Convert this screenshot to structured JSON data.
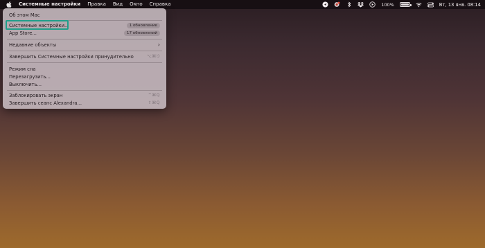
{
  "menubar": {
    "apple_icon": "apple-icon",
    "app_name": "Системные настройки",
    "menus": [
      "Правка",
      "Вид",
      "Окно",
      "Справка"
    ],
    "status": {
      "icons": [
        "location-arrow-icon",
        "focus-app-icon",
        "bluetooth-icon",
        "dropbox-icon",
        "play-circle-icon",
        "wifi-icon",
        "control-center-icon"
      ],
      "battery_percent": "100%",
      "battery_level": 1.0,
      "date": "Вт, 13 янв.",
      "time": "08:14"
    }
  },
  "apple_menu": {
    "items": [
      {
        "label": "Об этом Mac"
      },
      {
        "label": "Системные настройки...",
        "badge": "1 обновление",
        "highlighted": true
      },
      {
        "label": "App Store...",
        "badge": "17 обновлений"
      },
      {
        "label": "Недавние объекты",
        "submenu": true
      },
      {
        "label": "Завершить Системные настройки принудительно",
        "shortcut": "⌥⌘⎋"
      },
      {
        "label": "Режим сна"
      },
      {
        "label": "Перезагрузить..."
      },
      {
        "label": "Выключить..."
      },
      {
        "label": "Заблокировать экран",
        "shortcut": "^⌘Q"
      },
      {
        "label": "Завершить сеанс Alexandra...",
        "shortcut": "⇧⌘Q"
      }
    ]
  },
  "colors": {
    "highlight_border": "#1f9e8a",
    "menu_bg": "#c4b8be",
    "menubar_bg": "#160e12"
  }
}
